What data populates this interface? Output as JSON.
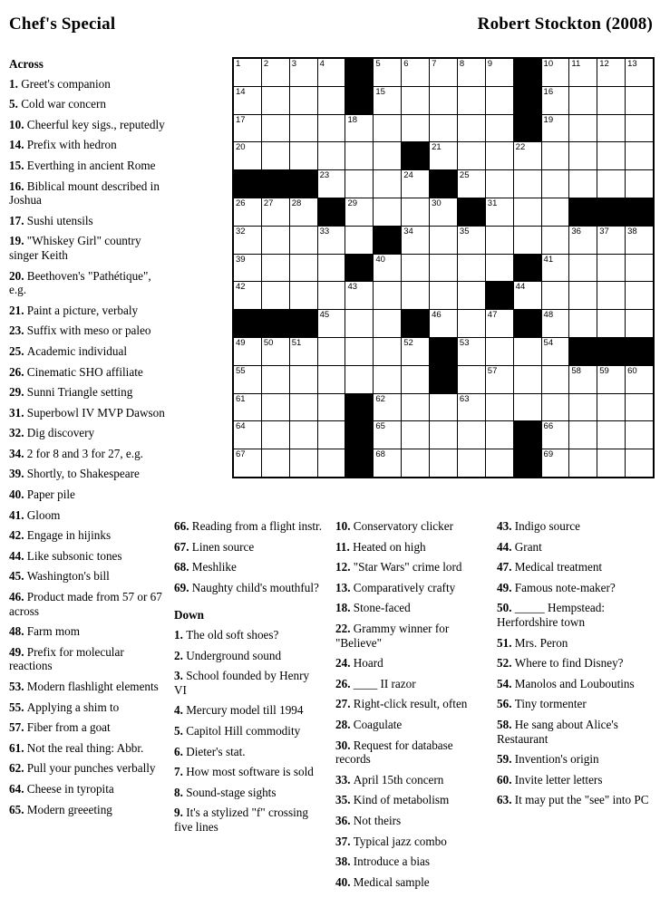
{
  "header": {
    "title": "Chef's Special",
    "author": "Robert Stockton (2008)"
  },
  "labels": {
    "across_heading": "Across",
    "down_heading": "Down"
  },
  "grid": {
    "rows": 15,
    "cols": 15,
    "cell_color": "#ffffff",
    "block_color": "#000000",
    "layout": [
      "....#.....#....",
      "....#.....#....",
      "..........#....",
      "......#........",
      "###....#.......",
      "...#....#...###",
      ".....#.........",
      "....#.....#....",
      ".........#.....",
      "###...#...#....",
      ".......#....###",
      ".......#.......",
      "....#..........",
      "....#.....#....",
      "....#.....#...."
    ],
    "numbers": {
      "0": {
        "0": "1",
        "1": "2",
        "2": "3",
        "3": "4",
        "5": "5",
        "6": "6",
        "7": "7",
        "8": "8",
        "9": "9",
        "11": "10",
        "12": "11",
        "13": "12",
        "14": "13"
      },
      "1": {
        "0": "14",
        "5": "15",
        "11": "16"
      },
      "2": {
        "0": "17",
        "4": "18",
        "11": "19"
      },
      "3": {
        "0": "20",
        "7": "21",
        "10": "22"
      },
      "4": {
        "3": "23",
        "6": "24",
        "8": "25"
      },
      "5": {
        "0": "26",
        "1": "27",
        "2": "28",
        "4": "29",
        "7": "30",
        "9": "31"
      },
      "6": {
        "0": "32",
        "3": "33",
        "6": "34",
        "8": "35",
        "12": "36",
        "13": "37",
        "14": "38"
      },
      "7": {
        "0": "39",
        "5": "40",
        "11": "41"
      },
      "8": {
        "0": "42",
        "4": "43",
        "10": "44"
      },
      "9": {
        "3": "45",
        "7": "46",
        "9": "47",
        "11": "48"
      },
      "10": {
        "0": "49",
        "1": "50",
        "2": "51",
        "6": "52",
        "8": "53",
        "11": "54"
      },
      "11": {
        "0": "55",
        "7": "56",
        "9": "57",
        "12": "58",
        "13": "59",
        "14": "60"
      },
      "12": {
        "0": "61",
        "5": "62",
        "8": "63"
      },
      "13": {
        "0": "64",
        "5": "65",
        "11": "66"
      },
      "14": {
        "0": "67",
        "5": "68",
        "11": "69"
      }
    }
  },
  "across": [
    {
      "n": "1.",
      "text": "Greet's companion"
    },
    {
      "n": "5.",
      "text": "Cold war concern"
    },
    {
      "n": "10.",
      "text": "Cheerful key sigs., reputedly"
    },
    {
      "n": "14.",
      "text": "Prefix with hedron"
    },
    {
      "n": "15.",
      "text": "Everthing in ancient Rome"
    },
    {
      "n": "16.",
      "text": "Biblical mount described in Joshua"
    },
    {
      "n": "17.",
      "text": "Sushi utensils"
    },
    {
      "n": "19.",
      "text": "\"Whiskey Girl\" country singer Keith"
    },
    {
      "n": "20.",
      "text": "Beethoven's \"Pathétique\", e.g."
    },
    {
      "n": "21.",
      "text": "Paint a picture, verbaly"
    },
    {
      "n": "23.",
      "text": "Suffix with meso or paleo"
    },
    {
      "n": "25.",
      "text": "Academic individual"
    },
    {
      "n": "26.",
      "text": "Cinematic SHO affiliate"
    },
    {
      "n": "29.",
      "text": "Sunni Triangle setting"
    },
    {
      "n": "31.",
      "text": "Superbowl IV MVP Dawson"
    },
    {
      "n": "32.",
      "text": "Dig discovery"
    },
    {
      "n": "34.",
      "text": "2 for 8 and 3 for 27, e.g."
    },
    {
      "n": "39.",
      "text": "Shortly, to Shakespeare"
    },
    {
      "n": "40.",
      "text": "Paper pile"
    },
    {
      "n": "41.",
      "text": "Gloom"
    },
    {
      "n": "42.",
      "text": "Engage in hijinks"
    },
    {
      "n": "44.",
      "text": "Like subsonic tones"
    },
    {
      "n": "45.",
      "text": "Washington's bill"
    },
    {
      "n": "46.",
      "text": "Product made from 57 or 67 across"
    },
    {
      "n": "48.",
      "text": "Farm mom"
    },
    {
      "n": "49.",
      "text": "Prefix for molecular reactions"
    },
    {
      "n": "53.",
      "text": "Modern flashlight elements"
    },
    {
      "n": "55.",
      "text": "Applying a shim to"
    },
    {
      "n": "57.",
      "text": "Fiber from a goat"
    },
    {
      "n": "61.",
      "text": "Not the real thing: Abbr."
    },
    {
      "n": "62.",
      "text": "Pull your punches verbally"
    },
    {
      "n": "64.",
      "text": "Cheese in tyropita"
    },
    {
      "n": "65.",
      "text": "Modern greeeting"
    },
    {
      "n": "66.",
      "text": "Reading from a flight instr."
    },
    {
      "n": "67.",
      "text": "Linen source"
    },
    {
      "n": "68.",
      "text": "Meshlike"
    },
    {
      "n": "69.",
      "text": "Naughty child's mouthful?"
    }
  ],
  "down": [
    {
      "n": "1.",
      "text": "The old soft shoes?"
    },
    {
      "n": "2.",
      "text": "Underground sound"
    },
    {
      "n": "3.",
      "text": "School founded by Henry VI"
    },
    {
      "n": "4.",
      "text": "Mercury model till 1994"
    },
    {
      "n": "5.",
      "text": "Capitol Hill commodity"
    },
    {
      "n": "6.",
      "text": "Dieter's stat."
    },
    {
      "n": "7.",
      "text": "How most software is sold"
    },
    {
      "n": "8.",
      "text": "Sound-stage sights"
    },
    {
      "n": "9.",
      "text": "It's a stylized \"f\" crossing five lines"
    },
    {
      "n": "10.",
      "text": "Conservatory clicker"
    },
    {
      "n": "11.",
      "text": "Heated on high"
    },
    {
      "n": "12.",
      "text": "\"Star Wars\" crime lord"
    },
    {
      "n": "13.",
      "text": "Comparatively crafty"
    },
    {
      "n": "18.",
      "text": "Stone-faced"
    },
    {
      "n": "22.",
      "text": "Grammy winner for \"Believe\""
    },
    {
      "n": "24.",
      "text": "Hoard"
    },
    {
      "n": "26.",
      "text": "____ II razor"
    },
    {
      "n": "27.",
      "text": "Right-click result, often"
    },
    {
      "n": "28.",
      "text": "Coagulate"
    },
    {
      "n": "30.",
      "text": "Request for database records"
    },
    {
      "n": "33.",
      "text": "April 15th concern"
    },
    {
      "n": "35.",
      "text": "Kind of metabolism"
    },
    {
      "n": "36.",
      "text": "Not theirs"
    },
    {
      "n": "37.",
      "text": "Typical jazz combo"
    },
    {
      "n": "38.",
      "text": "Introduce a bias"
    },
    {
      "n": "40.",
      "text": "Medical sample"
    },
    {
      "n": "43.",
      "text": "Indigo source"
    },
    {
      "n": "44.",
      "text": "Grant"
    },
    {
      "n": "47.",
      "text": "Medical treatment"
    },
    {
      "n": "49.",
      "text": "Famous note-maker?"
    },
    {
      "n": "50.",
      "text": "_____ Hempstead: Herfordshire town"
    },
    {
      "n": "51.",
      "text": "Mrs. Peron"
    },
    {
      "n": "52.",
      "text": "Where to find Disney?"
    },
    {
      "n": "54.",
      "text": "Manolos and Louboutins"
    },
    {
      "n": "56.",
      "text": "Tiny tormenter"
    },
    {
      "n": "58.",
      "text": "He sang about Alice's Restaurant"
    },
    {
      "n": "59.",
      "text": "Invention's origin"
    },
    {
      "n": "60.",
      "text": "Invite letter letters"
    },
    {
      "n": "63.",
      "text": "It may put the \"see\" into PC"
    }
  ],
  "column_split": {
    "col1_across": [
      0,
      32
    ],
    "col2_across": [
      33,
      36
    ],
    "col2_down": [
      0,
      8
    ],
    "col3_down": [
      9,
      25
    ],
    "col4_down": [
      26,
      38
    ]
  }
}
